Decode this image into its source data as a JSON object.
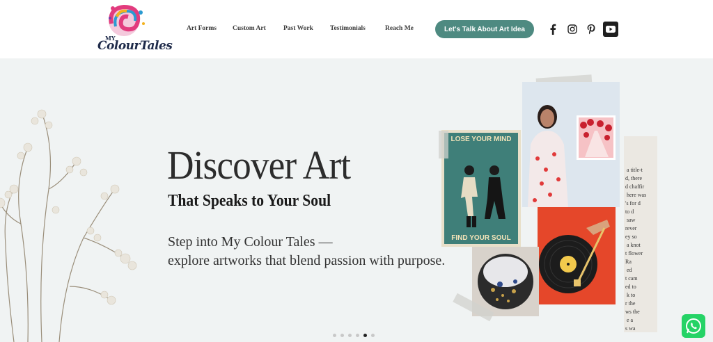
{
  "header": {
    "logo_small": "MY",
    "logo_text": "ColourTales",
    "nav": [
      "Art Forms",
      "Custom Art",
      "Past Work",
      "Testimonials",
      "Reach Me"
    ],
    "cta": "Let's Talk About Art Idea",
    "social_icons": [
      "facebook-icon",
      "instagram-icon",
      "pinterest-icon",
      "youtube-icon"
    ]
  },
  "hero": {
    "title": "Discover Art",
    "subtitle": "That Speaks to Your Soul",
    "body_line1": "Step into My Colour Tales —",
    "body_line2": "explore artworks that blend passion with purpose.",
    "poster_top": "LOSE YOUR MIND",
    "poster_bottom": "FIND YOUR SOUL",
    "paper_lines": [
      "a title-t",
      "d, there",
      "d chaffir",
      "here was",
      "'s for d",
      "to d",
      "saw",
      "rever",
      "ey so",
      "a knot",
      "t flower",
      "Ra",
      "ed",
      "t cam",
      "ed to",
      "k to",
      "r the",
      "ws the",
      "e a",
      "s wa"
    ],
    "carousel_dots": 6,
    "active_dot": 4
  },
  "colors": {
    "accent": "#4e8a81",
    "hero_bg": "#f0f3f3",
    "whatsapp": "#25d366"
  }
}
